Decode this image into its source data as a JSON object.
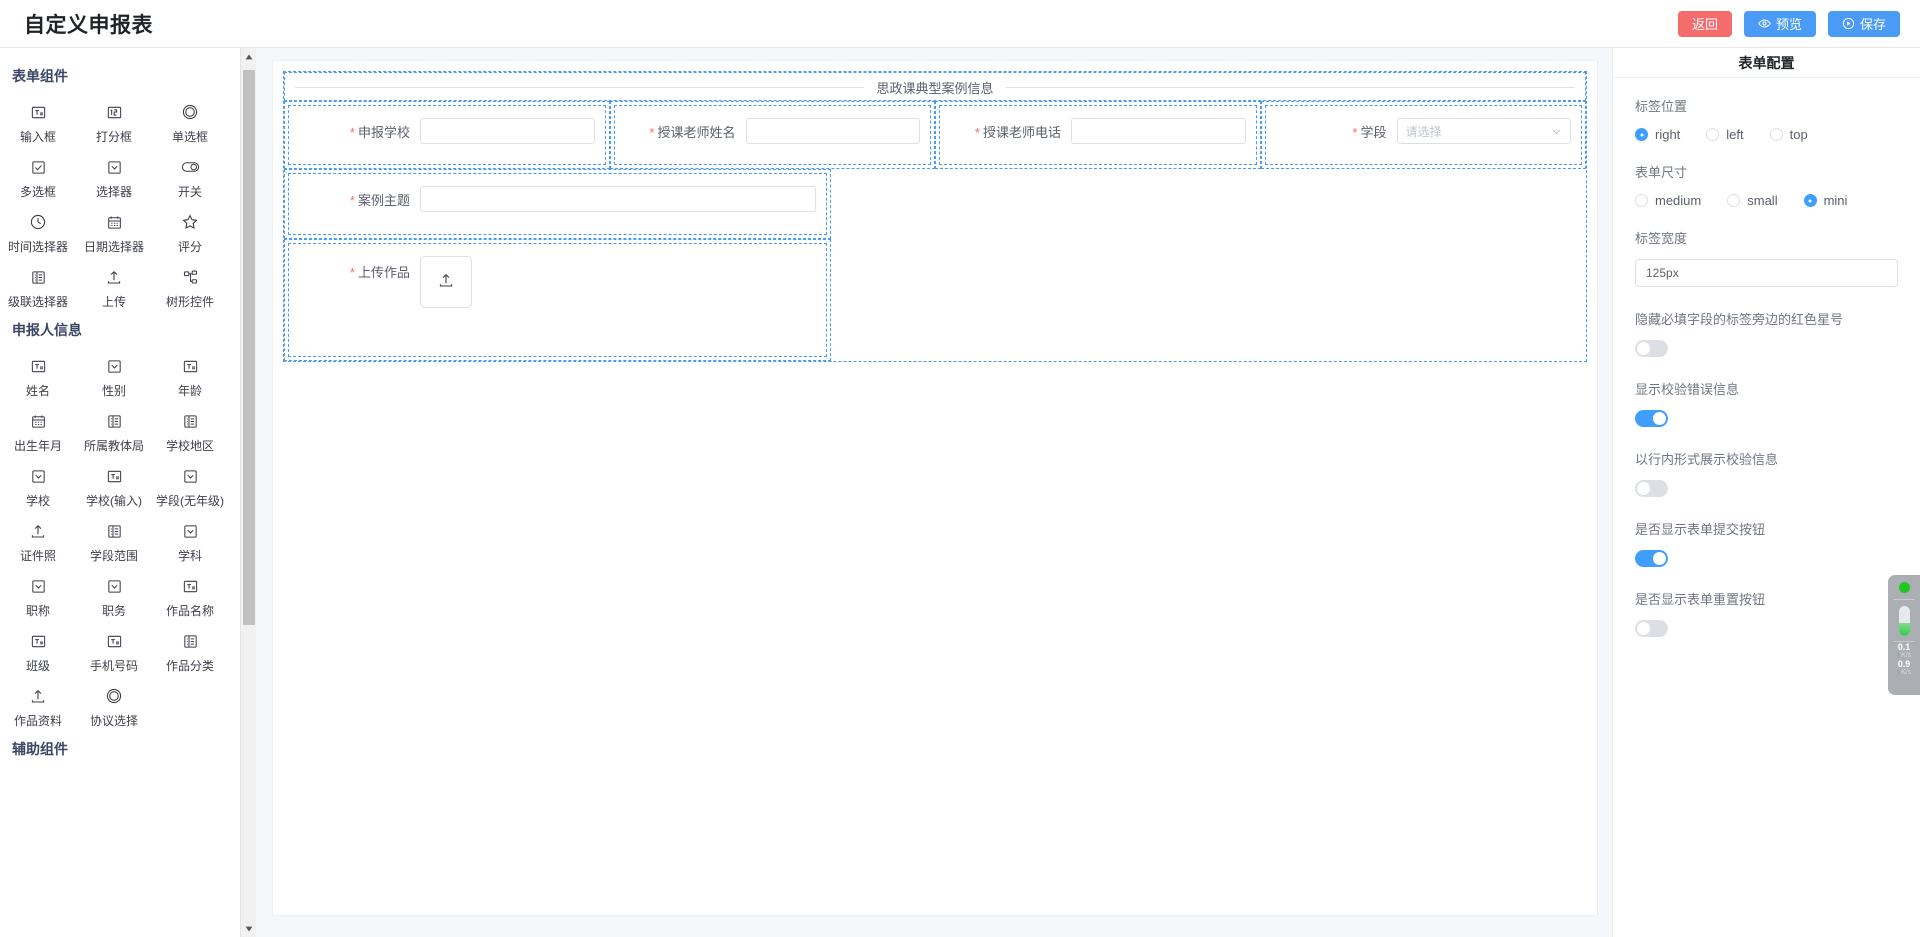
{
  "header": {
    "title": "自定义申报表",
    "buttons": [
      {
        "label": "返回",
        "icon": "none",
        "style": "danger"
      },
      {
        "label": "预览",
        "icon": "eye-icon",
        "style": "primary"
      },
      {
        "label": "保存",
        "icon": "play-circle-icon",
        "style": "primary"
      }
    ]
  },
  "sidebar": {
    "groups": [
      {
        "title": "表单组件",
        "items": [
          {
            "label": "输入框",
            "icon": "text-input-icon"
          },
          {
            "label": "打分框",
            "icon": "number-input-icon"
          },
          {
            "label": "单选框",
            "icon": "radio-circle-icon"
          },
          {
            "label": "多选框",
            "icon": "checkbox-icon"
          },
          {
            "label": "选择器",
            "icon": "select-chevron-icon"
          },
          {
            "label": "开关",
            "icon": "switch-icon"
          },
          {
            "label": "时间选择器",
            "icon": "clock-icon"
          },
          {
            "label": "日期选择器",
            "icon": "calendar-icon"
          },
          {
            "label": "评分",
            "icon": "star-icon"
          },
          {
            "label": "级联选择器",
            "icon": "cascader-icon"
          },
          {
            "label": "上传",
            "icon": "upload-icon"
          },
          {
            "label": "树形控件",
            "icon": "tree-icon"
          }
        ]
      },
      {
        "title": "申报人信息",
        "items": [
          {
            "label": "姓名",
            "icon": "text-input-icon"
          },
          {
            "label": "性别",
            "icon": "select-chevron-icon"
          },
          {
            "label": "年龄",
            "icon": "text-input-icon"
          },
          {
            "label": "出生年月",
            "icon": "calendar-icon"
          },
          {
            "label": "所属教体局",
            "icon": "cascader-icon"
          },
          {
            "label": "学校地区",
            "icon": "cascader-icon"
          },
          {
            "label": "学校",
            "icon": "select-chevron-icon"
          },
          {
            "label": "学校(输入)",
            "icon": "text-input-icon"
          },
          {
            "label": "学段(无年级)",
            "icon": "select-chevron-icon"
          },
          {
            "label": "证件照",
            "icon": "upload-icon"
          },
          {
            "label": "学段范围",
            "icon": "cascader-icon"
          },
          {
            "label": "学科",
            "icon": "select-chevron-icon"
          },
          {
            "label": "职称",
            "icon": "select-chevron-icon"
          },
          {
            "label": "职务",
            "icon": "select-chevron-icon"
          },
          {
            "label": "作品名称",
            "icon": "text-input-icon"
          },
          {
            "label": "班级",
            "icon": "text-input-icon"
          },
          {
            "label": "手机号码",
            "icon": "text-input-icon"
          },
          {
            "label": "作品分类",
            "icon": "cascader-icon"
          },
          {
            "label": "作品资料",
            "icon": "upload-icon"
          },
          {
            "label": "协议选择",
            "icon": "radio-circle-icon"
          }
        ]
      },
      {
        "title": "辅助组件",
        "items": []
      }
    ]
  },
  "canvas": {
    "divider": {
      "text": "思政课典型案例信息"
    },
    "row_fields": [
      {
        "label": "申报学校",
        "required": true,
        "type": "input",
        "value": "",
        "placeholder": ""
      },
      {
        "label": "授课老师姓名",
        "required": true,
        "type": "input",
        "value": "",
        "placeholder": ""
      },
      {
        "label": "授课老师电话",
        "required": true,
        "type": "input",
        "value": "",
        "placeholder": ""
      },
      {
        "label": "学段",
        "required": true,
        "type": "select",
        "value": "",
        "placeholder": "请选择"
      }
    ],
    "stacked_fields": [
      {
        "label": "案例主题",
        "required": true,
        "type": "input",
        "value": "",
        "placeholder": ""
      },
      {
        "label": "上传作品",
        "required": true,
        "type": "upload",
        "upload_icon": "upload-arrow-icon"
      }
    ]
  },
  "config_panel": {
    "title": "表单配置",
    "sections": [
      {
        "kind": "radio",
        "label": "标签位置",
        "options": [
          {
            "label": "right",
            "selected": true
          },
          {
            "label": "left",
            "selected": false
          },
          {
            "label": "top",
            "selected": false
          }
        ]
      },
      {
        "kind": "radio",
        "label": "表单尺寸",
        "options": [
          {
            "label": "medium",
            "selected": false
          },
          {
            "label": "small",
            "selected": false
          },
          {
            "label": "mini",
            "selected": true
          }
        ]
      },
      {
        "kind": "input",
        "label": "标签宽度",
        "value": "125px"
      },
      {
        "kind": "switch",
        "label": "隐藏必填字段的标签旁边的红色星号",
        "on": false
      },
      {
        "kind": "switch",
        "label": "显示校验错误信息",
        "on": true
      },
      {
        "kind": "switch",
        "label": "以行内形式展示校验信息",
        "on": false
      },
      {
        "kind": "switch",
        "label": "是否显示表单提交按钮",
        "on": true
      },
      {
        "kind": "switch",
        "label": "是否显示表单重置按钮",
        "on": false
      }
    ]
  },
  "net_monitor": {
    "status_color": "#1ec81e",
    "upload": {
      "value": "0.1",
      "unit": "K/s"
    },
    "download": {
      "value": "0.9",
      "unit": "K/s"
    }
  },
  "colors": {
    "accent": "#409eff",
    "primary_button": "#4a9bf5",
    "danger_button": "#f56c6c",
    "required_star": "#f56c6c",
    "dashed_outline": "#4a9bf5",
    "canvas_bg": "#f5f7fa"
  }
}
